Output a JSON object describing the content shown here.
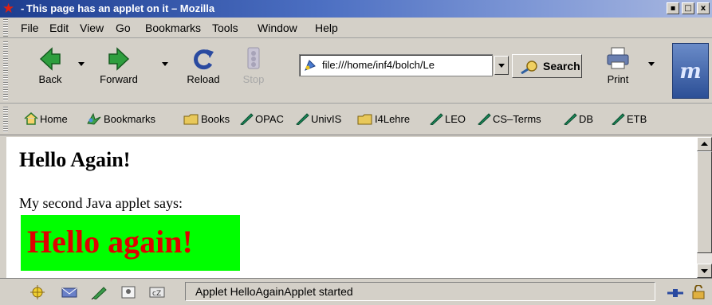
{
  "window": {
    "title": "- This page has an applet on it – Mozilla"
  },
  "menu": [
    "File",
    "Edit",
    "View",
    "Go",
    "Bookmarks",
    "Tools",
    "Window",
    "Help"
  ],
  "toolbar": {
    "back": "Back",
    "forward": "Forward",
    "reload": "Reload",
    "stop": "Stop",
    "url": "file:///home/inf4/bolch/Le",
    "search": "Search",
    "print": "Print"
  },
  "personal_toolbar": [
    "Home",
    "Bookmarks",
    "Books",
    "OPAC",
    "UnivIS",
    "I4Lehre",
    "LEO",
    "CS–Terms",
    "DB",
    "ETB"
  ],
  "page": {
    "heading": "Hello Again!",
    "paragraph": "My second Java applet says:",
    "applet_text": "Hello again!"
  },
  "status": {
    "text": "Applet HelloAgainApplet started"
  },
  "colors": {
    "applet_bg": "#00ff00",
    "applet_text": "#e00000"
  }
}
